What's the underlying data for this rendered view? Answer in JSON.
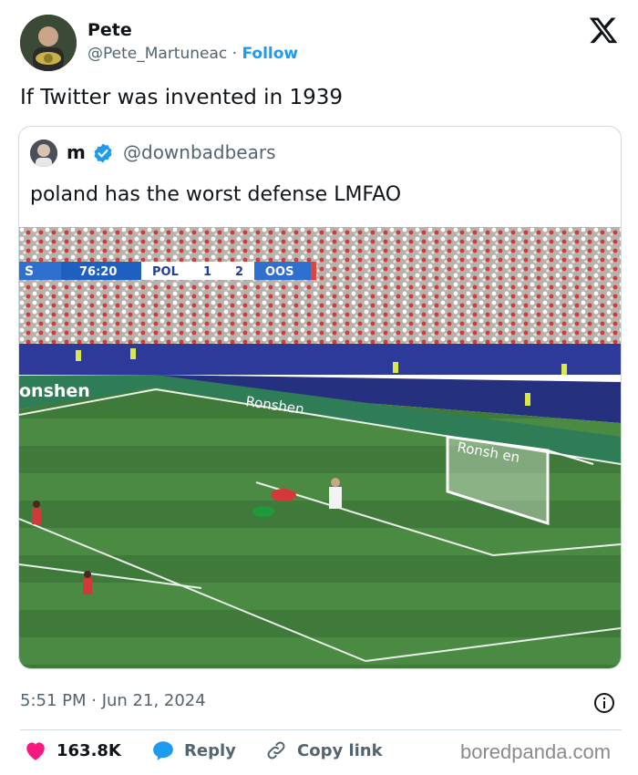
{
  "author": {
    "name": "Pete",
    "handle": "@Pete_Martuneac",
    "separator": "·",
    "follow_label": "Follow"
  },
  "tweet": {
    "text": "If Twitter was invented in 1939"
  },
  "quoted": {
    "name": "m",
    "handle": "@downbadbears",
    "text": "poland has the worst defense LMFAO",
    "media": {
      "scoreboard": {
        "left_team": "S",
        "time": "76:20",
        "home": "POL",
        "home_score": "1",
        "away_score": "2",
        "away": "OOS"
      },
      "board_text_1": "onshen",
      "board_text_2": "Ronshen",
      "board_text_3": "Ronshen",
      "board_text_4": "Ronsh en"
    }
  },
  "footer": {
    "timestamp": "5:51 PM · Jun 21, 2024",
    "likes": "163.8K",
    "reply_label": "Reply",
    "copy_label": "Copy link",
    "watermark": "boredpanda.com"
  },
  "colors": {
    "like": "#f91880",
    "link": "#1d9bf0",
    "verified": "#1d9bf0",
    "pitch": "#3f7a3a"
  }
}
